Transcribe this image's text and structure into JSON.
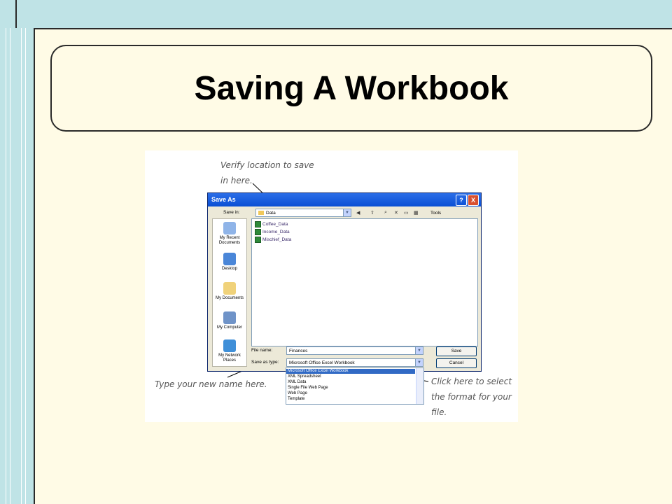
{
  "slide": {
    "title": "Saving A Workbook"
  },
  "callouts": {
    "location": [
      "Verify location to save",
      "in here."
    ],
    "name": "Type your new name here.",
    "format": [
      "Click here to select",
      "the format for your",
      "file."
    ]
  },
  "dialog": {
    "title": "Save As",
    "help_button": "?",
    "close_button": "X",
    "save_in_label": "Save in:",
    "save_in_value": "Data",
    "tools_label": "Tools",
    "places": [
      "My Recent Documents",
      "Desktop",
      "My Documents",
      "My Computer",
      "My Network Places"
    ],
    "files": [
      "Coffee_Data",
      "Income_Data",
      "Mischief_Data"
    ],
    "file_name_label": "File name:",
    "file_name_value": "Finances",
    "save_as_type_label": "Save as type:",
    "save_as_type_value": "Microsoft Office Excel Workbook",
    "save_button": "Save",
    "cancel_button": "Cancel",
    "type_options": [
      "Microsoft Office Excel Workbook",
      "XML Spreadsheet",
      "XML Data",
      "Single File Web Page",
      "Web Page",
      "Template"
    ]
  },
  "colors": {
    "slide_bg": "#fffbe6",
    "frame": "#bfe3e6",
    "titlebar": "#0a4fd4",
    "selection": "#316ac5"
  }
}
